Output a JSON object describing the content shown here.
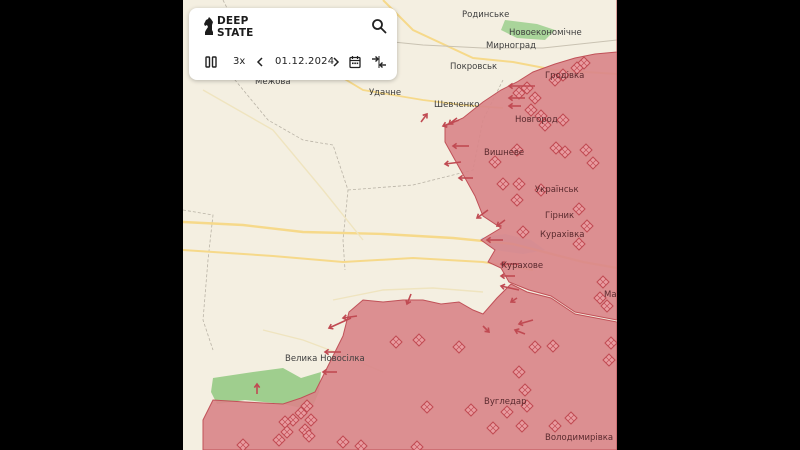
{
  "app": {
    "logo_line1": "DEEP",
    "logo_line2": "STATE",
    "icons": [
      "knight-icon",
      "search-icon",
      "pause-icon",
      "chevron-left-icon",
      "chevron-right-icon",
      "calendar-icon",
      "compare-icon"
    ]
  },
  "timeline": {
    "speed": "3x",
    "date": "01.12.2024"
  },
  "colors": {
    "occupied": "#d9878a",
    "occupied_border": "#c05158",
    "base_map": "#f4efe1",
    "forest": "#9fce8e",
    "road": "#f6d98a",
    "water": "#b8d8ef"
  },
  "towns": {
    "rodynske": "Родинське",
    "novoekonomichne": "Новоекономічне",
    "myrnohrad": "Мирноград",
    "pokrovsk": "Покровськ",
    "hrodivka": "Гродівка",
    "mezhova": "Межова",
    "udachne": "Удачне",
    "shevchenko": "Шевченко",
    "novohrodivka": "Новгород",
    "vyshneve": "Вишневе",
    "ukrainsk": "Українськ",
    "hirnyk": "Гірник",
    "kurakhivka": "Курахівка",
    "kurakhove": "Курахове",
    "marinka": "Мар",
    "velyka_novosilka": "Велика Новосілка",
    "vuhledar": "Вугледар",
    "volodymyrivka": "Володимирівка"
  }
}
